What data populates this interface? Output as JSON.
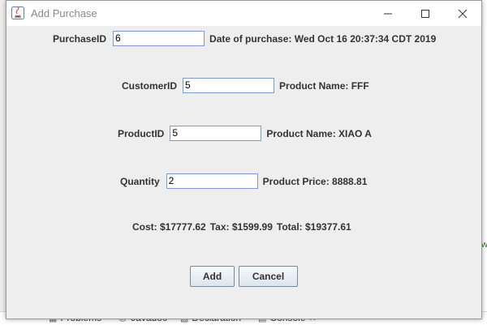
{
  "window": {
    "title": "Add Purchase",
    "minimize_icon": "minimize-icon",
    "maximize_icon": "maximize-icon",
    "close_icon": "close-icon"
  },
  "form": {
    "purchase_id": {
      "label": "PurchaseID",
      "value": "6"
    },
    "date_of_purchase": "Date of purchase: Wed Oct 16 20:37:34 CDT 2019",
    "customer_id": {
      "label": "CustomerID",
      "value": "5"
    },
    "customer_product_name": "Product Name: FFF",
    "product_id": {
      "label": "ProductID",
      "value": "5"
    },
    "product_name": "Product Name: XIAO A",
    "quantity": {
      "label": "Quantity",
      "value": "2"
    },
    "product_price": "Product Price: 8888.81",
    "summary": {
      "cost": "Cost: $17777.62",
      "tax": "Tax: $1599.99",
      "total": "Total: $19377.61"
    }
  },
  "buttons": {
    "add": "Add",
    "cancel": "Cancel"
  },
  "background": {
    "tabs": [
      "Problems",
      "Javadoc",
      "Declaration",
      "Console"
    ],
    "edge_char": "w"
  },
  "colors": {
    "field_border": "#7a9cd3",
    "title_text": "#8a8a8a",
    "dialog_bg": "#eeeeee"
  }
}
